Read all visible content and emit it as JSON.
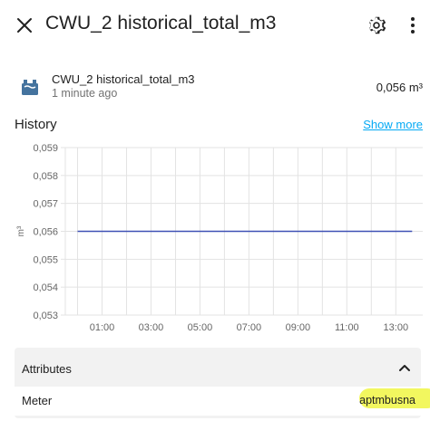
{
  "dialog": {
    "title": "CWU_2 historical_total_m3",
    "close_icon": "close-icon",
    "settings_icon": "gear-icon",
    "menu_icon": "more-vertical-icon"
  },
  "entity": {
    "icon": "water-heater-icon",
    "name": "CWU_2 historical_total_m3",
    "last_updated": "1 minute ago",
    "state": "0,056 m³"
  },
  "history": {
    "label": "History",
    "show_more": "Show more"
  },
  "chart_data": {
    "type": "line",
    "x": [
      "00:00",
      "01:00",
      "02:00",
      "03:00",
      "04:00",
      "05:00",
      "06:00",
      "07:00",
      "08:00",
      "09:00",
      "10:00",
      "11:00",
      "12:00",
      "13:00",
      "13:40"
    ],
    "series": [
      {
        "values": [
          0.056,
          0.056,
          0.056,
          0.056,
          0.056,
          0.056,
          0.056,
          0.056,
          0.056,
          0.056,
          0.056,
          0.056,
          0.056,
          0.056,
          0.056
        ]
      }
    ],
    "ylabel": "m³",
    "ylim": [
      0.053,
      0.059
    ],
    "ytick_labels": [
      "0,059",
      "0,058",
      "0,057",
      "0,056",
      "0,055",
      "0,054",
      "0,053"
    ],
    "xtick_labels": [
      "01:00",
      "03:00",
      "05:00",
      "07:00",
      "09:00",
      "11:00",
      "13:00"
    ],
    "grid": true,
    "line_color": "#3f51b5"
  },
  "attributes": {
    "title": "Attributes",
    "collapse_icon": "chevron-up-icon",
    "rows": [
      {
        "key": "Meter",
        "value": "aptmbusna"
      }
    ],
    "highlight_color": "#f2f75f"
  }
}
